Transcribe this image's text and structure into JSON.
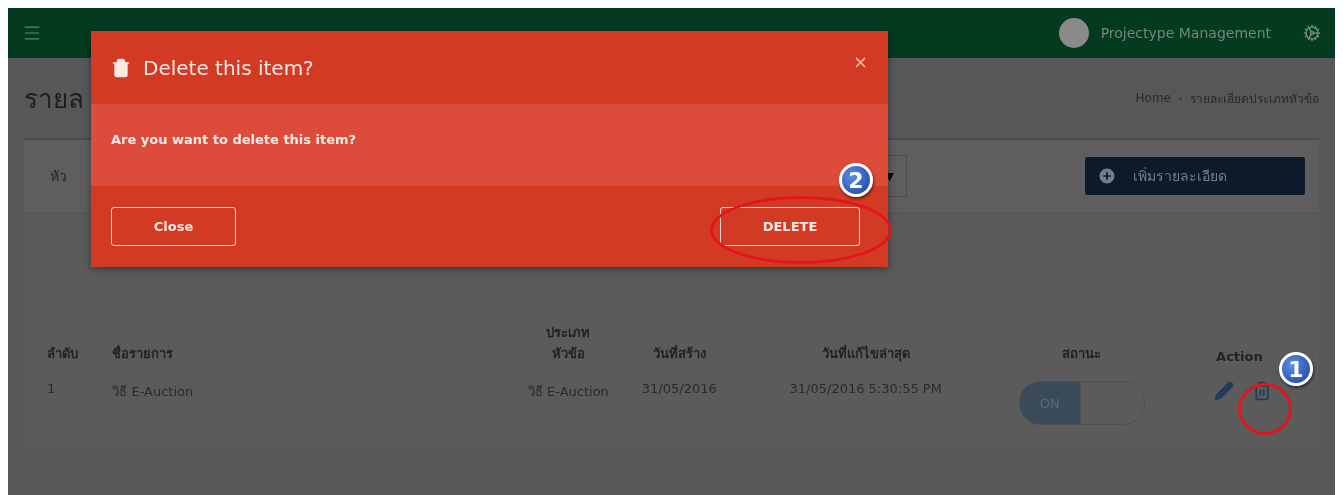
{
  "header": {
    "brand": "Projectype Management"
  },
  "page": {
    "title": "รายล",
    "breadcrumb": [
      "Home",
      "รายละเอียดประเภทหัวข้อ"
    ]
  },
  "filter": {
    "label": "หัว",
    "select_caret": "▼",
    "add_button": "เพิ่มรายละเอียด"
  },
  "table": {
    "columns": [
      "ลำดับ",
      "ชื่อรายการ",
      "ประเภท หัวข้อ",
      "วันที่สร้าง",
      "วันที่แก้ไขล่าสุด",
      "สถานะ",
      "Action"
    ],
    "rows": [
      {
        "cells": [
          "1",
          "วิธี E-Auction",
          "วิธี E-Auction",
          "31/05/2016",
          "31/05/2016 5:30:55 PM"
        ],
        "status": {
          "label": "ON",
          "on": true
        }
      }
    ]
  },
  "modal": {
    "title": "Delete this item?",
    "close_mark": "×",
    "message": "Are you want to delete this item?",
    "buttons": [
      {
        "label": "Close",
        "kind": "close"
      },
      {
        "label": "DELETE",
        "kind": "delete"
      }
    ]
  },
  "annotations": [
    {
      "number": "1"
    },
    {
      "number": "2"
    }
  ]
}
